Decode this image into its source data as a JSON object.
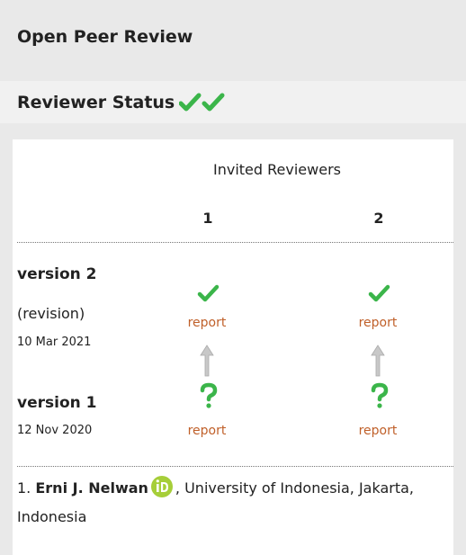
{
  "header": {
    "title": "Open Peer Review"
  },
  "status": {
    "title": "Reviewer Status",
    "tick_icons": [
      "check-icon",
      "check-icon"
    ]
  },
  "table": {
    "invited_label": "Invited Reviewers",
    "columns": [
      "1",
      "2"
    ],
    "versions": [
      {
        "label": "version 2",
        "sub_label": "(revision)",
        "date": "10 Mar 2021",
        "reviews": [
          {
            "status": "approved",
            "icon": "check-icon",
            "link": "report"
          },
          {
            "status": "approved",
            "icon": "check-icon",
            "link": "report"
          }
        ]
      },
      {
        "label": "version 1",
        "date": "12 Nov 2020",
        "reviews": [
          {
            "status": "approved-with-reservations",
            "icon": "question-icon",
            "link": "report"
          },
          {
            "status": "approved-with-reservations",
            "icon": "question-icon",
            "link": "report"
          }
        ]
      }
    ],
    "arrow_icon": "up-arrow-icon"
  },
  "reviewers": [
    {
      "number": "1.",
      "name": "Erni J. Nelwan",
      "orcid_icon": "orcid-icon",
      "affiliation": ", University of Indonesia, Jakarta, Indonesia"
    }
  ],
  "colors": {
    "approved_green": "#3bb54a",
    "link_orange": "#c0602a",
    "orcid_green": "#a6ce39"
  }
}
